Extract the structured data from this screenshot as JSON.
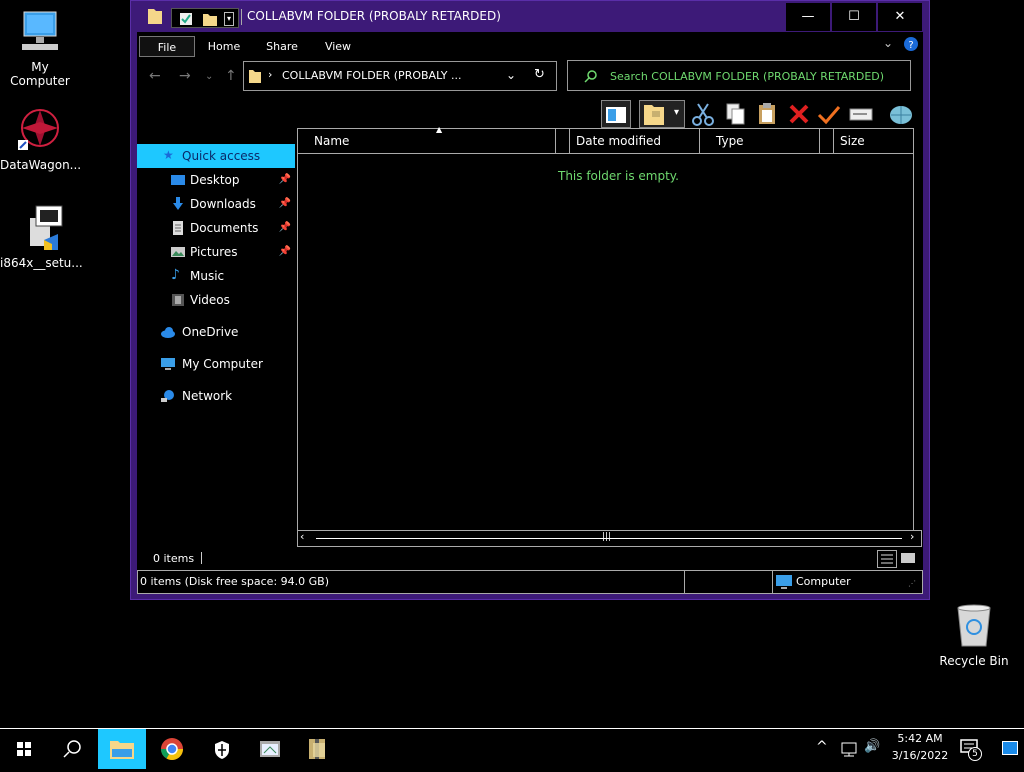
{
  "desktop": {
    "icons": [
      {
        "label": "My Computer"
      },
      {
        "label": "DataWagon..."
      },
      {
        "label": "i864x__setu..."
      },
      {
        "label": "Recycle Bin"
      }
    ]
  },
  "window": {
    "title": "COLLABVM FOLDER (PROBALY RETARDED)",
    "controls": {
      "minimize": "—",
      "maximize": "☐",
      "close": "✕"
    },
    "menu": [
      "File",
      "Home",
      "Share",
      "View"
    ],
    "address": "COLLABVM FOLDER (PROBALY ...",
    "search_placeholder": "Search COLLABVM FOLDER (PROBALY RETARDED)",
    "columns": [
      "Name",
      "Date modified",
      "Type",
      "Size"
    ],
    "empty_message": "This folder is empty.",
    "item_count": "0 items",
    "status_left": "0 items (Disk free space: 94.0 GB)",
    "status_right": "Computer"
  },
  "nav": {
    "quick_access": "Quick access",
    "items": [
      {
        "label": "Desktop",
        "pinned": true
      },
      {
        "label": "Downloads",
        "pinned": true
      },
      {
        "label": "Documents",
        "pinned": true
      },
      {
        "label": "Pictures",
        "pinned": true
      },
      {
        "label": "Music",
        "pinned": false
      },
      {
        "label": "Videos",
        "pinned": false
      }
    ],
    "onedrive": "OneDrive",
    "my_computer": "My Computer",
    "network": "Network"
  },
  "taskbar": {
    "time": "5:42 AM",
    "date": "3/16/2022",
    "notification_count": "5"
  },
  "colors": {
    "window_border": "#3d1a78",
    "accent": "#1ec8ff",
    "search_text": "#6fd96f"
  }
}
